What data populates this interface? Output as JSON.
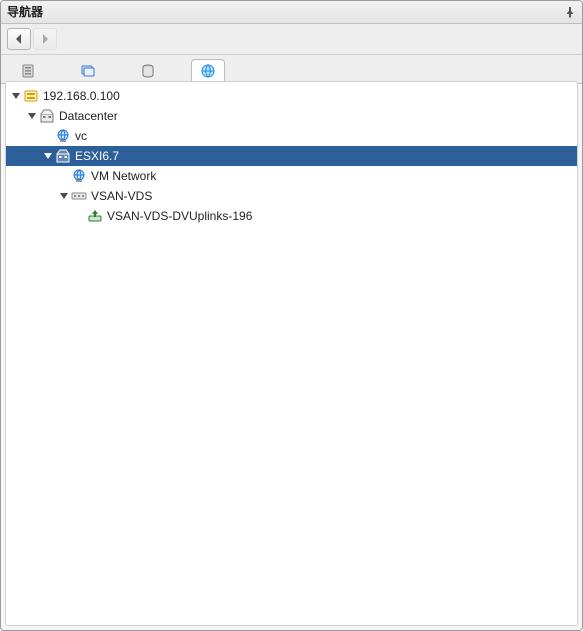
{
  "panel": {
    "title": "导航器"
  },
  "nav": {
    "back_enabled": true,
    "forward_enabled": false
  },
  "tabs": {
    "items": [
      {
        "id": "hosts",
        "icon": "hosts-icon"
      },
      {
        "id": "vms",
        "icon": "vms-icon"
      },
      {
        "id": "storage",
        "icon": "storage-icon"
      },
      {
        "id": "network",
        "icon": "network-icon",
        "active": true
      }
    ]
  },
  "tree": [
    {
      "id": "vc",
      "depth": 0,
      "expand": "open",
      "icon": "vcenter-icon",
      "label": "192.168.0.100",
      "selected": false
    },
    {
      "id": "dc",
      "depth": 1,
      "expand": "open",
      "icon": "datacenter-icon",
      "label": "Datacenter",
      "selected": false
    },
    {
      "id": "vc-net",
      "depth": 2,
      "expand": "none",
      "icon": "std-network-icon",
      "label": "vc",
      "selected": false
    },
    {
      "id": "esxi",
      "depth": 2,
      "expand": "open",
      "icon": "datacenter-icon",
      "label": "ESXI6.7",
      "selected": true
    },
    {
      "id": "vmnet",
      "depth": 3,
      "expand": "none",
      "icon": "std-network-icon",
      "label": "VM Network",
      "selected": false
    },
    {
      "id": "vds",
      "depth": 3,
      "expand": "open",
      "icon": "dvs-icon",
      "label": "VSAN-VDS",
      "selected": false
    },
    {
      "id": "uplinks",
      "depth": 4,
      "expand": "none",
      "icon": "uplink-pg-icon",
      "label": "VSAN-VDS-DVUplinks-196",
      "selected": false
    }
  ]
}
